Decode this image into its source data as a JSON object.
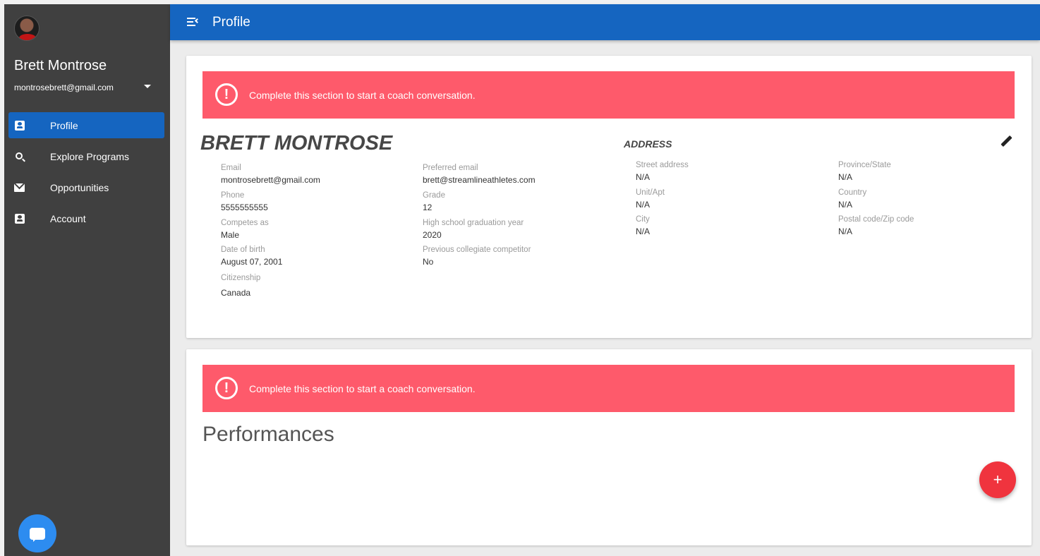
{
  "sidebar": {
    "user_name": "Brett Montrose",
    "user_email": "montrosebrett@gmail.com",
    "items": [
      {
        "label": "Profile",
        "icon": "account-box-icon",
        "active": true
      },
      {
        "label": "Explore Programs",
        "icon": "search-icon"
      },
      {
        "label": "Opportunities",
        "icon": "mail-icon"
      },
      {
        "label": "Account",
        "icon": "account-box-icon"
      }
    ]
  },
  "topbar": {
    "title": "Profile"
  },
  "alert": {
    "message": "Complete this section to start a coach conversation.",
    "icon": "!"
  },
  "profile": {
    "name": "BRETT MONTROSE",
    "fields_left": [
      {
        "label": "Email",
        "value": "montrosebrett@gmail.com"
      },
      {
        "label": "Phone",
        "value": "5555555555"
      },
      {
        "label": "Competes as",
        "value": "Male"
      },
      {
        "label": "Date of birth",
        "value": "August 07, 2001"
      },
      {
        "label": "Citizenship",
        "value": "Canada"
      }
    ],
    "fields_right": [
      {
        "label": "Preferred email",
        "value": "brett@streamlineathletes.com"
      },
      {
        "label": "Grade",
        "value": "12"
      },
      {
        "label": "High school graduation year",
        "value": "2020"
      },
      {
        "label": "Previous collegiate competitor",
        "value": "No"
      }
    ]
  },
  "address": {
    "title": "ADDRESS",
    "fields_left": [
      {
        "label": "Street address",
        "value": "N/A"
      },
      {
        "label": "Unit/Apt",
        "value": "N/A"
      },
      {
        "label": "City",
        "value": "N/A"
      }
    ],
    "fields_right": [
      {
        "label": "Province/State",
        "value": "N/A"
      },
      {
        "label": "Country",
        "value": "N/A"
      },
      {
        "label": "Postal code/Zip code",
        "value": "N/A"
      }
    ]
  },
  "performances": {
    "title": "Performances",
    "add_label": "+"
  },
  "colors": {
    "primary": "#1565c0",
    "alert": "#fe5a6b",
    "fab": "#f0343e",
    "sidebar": "#404040",
    "chat": "#2d8cf0"
  }
}
